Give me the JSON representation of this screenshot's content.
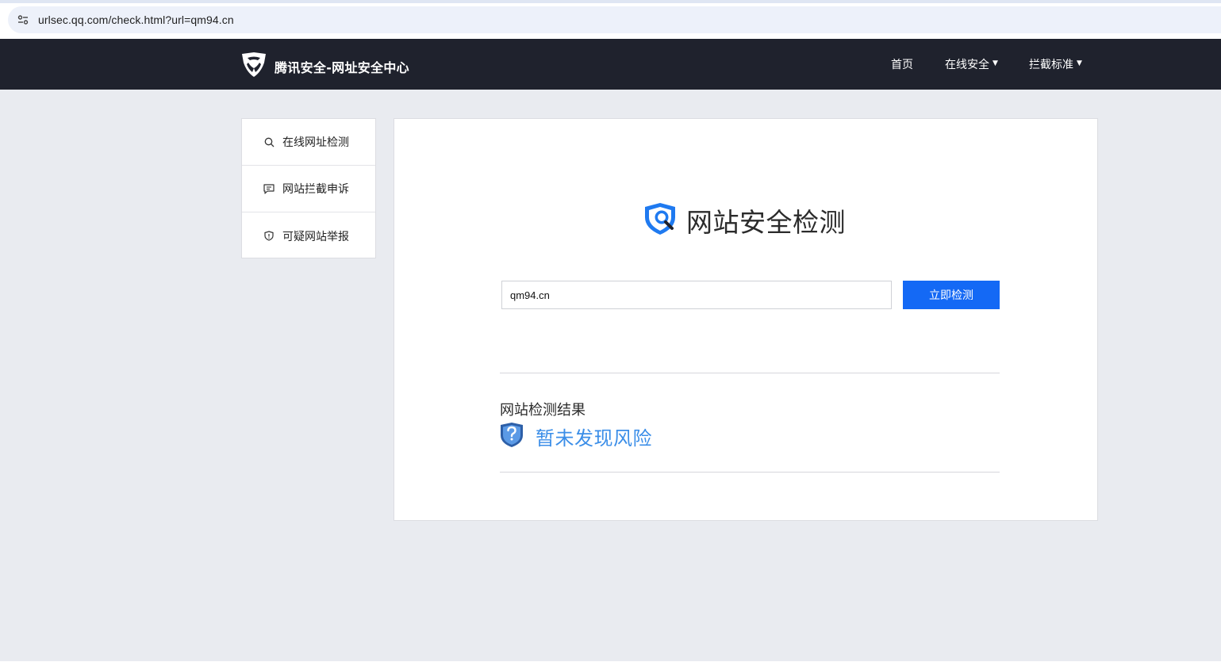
{
  "browser": {
    "url": "urlsec.qq.com/check.html?url=qm94.cn",
    "site_info_icon": "tune-icon"
  },
  "header": {
    "logo_icon": "tencent-security-shield-icon",
    "brand": "腾讯安全-网址安全中心",
    "nav": {
      "home": "首页",
      "online_security": "在线安全",
      "block_standard": "拦截标准"
    }
  },
  "sidebar": {
    "items": [
      {
        "label": "在线网址检测",
        "icon": "search-icon"
      },
      {
        "label": "网站拦截申诉",
        "icon": "message-icon"
      },
      {
        "label": "可疑网站举报",
        "icon": "shield-icon"
      }
    ]
  },
  "check": {
    "title": "网站安全检测",
    "title_icon": "shield-search-icon",
    "input_value": "qm94.cn",
    "button_label": "立即检测"
  },
  "result": {
    "label": "网站检测结果",
    "status_icon": "shield-question-icon",
    "status_text": "暂未发现风险",
    "status_color": "#3b8ee8"
  },
  "colors": {
    "header_bg": "#1f222d",
    "page_bg": "#e9ebf0",
    "primary": "#1469f5"
  }
}
